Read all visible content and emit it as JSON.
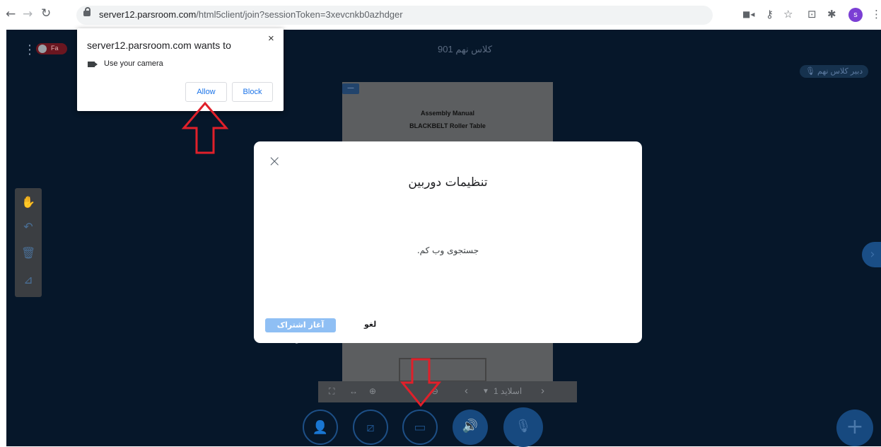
{
  "browser": {
    "url_host": "server12.parsroom.com",
    "url_path": "/html5client/join?sessionToken=3xevcnkb0azhdger",
    "profile_initial": "s",
    "icons": [
      "back-icon",
      "forward-icon",
      "reload-icon",
      "lock-icon",
      "camera-icon",
      "key-icon",
      "star-icon",
      "screenshot-icon",
      "extensions-icon",
      "menu-icon"
    ]
  },
  "permission_popup": {
    "title": "server12.parsroom.com wants to",
    "request": "Use your camera",
    "allow_label": "Allow",
    "block_label": "Block",
    "close_label": "×"
  },
  "app": {
    "room_name": "کلاس نهم 901",
    "language_toggle": "Fa",
    "teacher_badge": "دبیر کلاس نهم",
    "slide": {
      "title_line1": "Assembly Manual",
      "title_line2": "BLACKBELT Roller Table"
    },
    "slide_bar": {
      "slide_label": "اسلاید 1",
      "chevron_left": "‹",
      "chevron_right": "›"
    }
  },
  "modal": {
    "close_label": "×",
    "title": "تنظیمات دوربین",
    "message": "جستجوی وب کم.",
    "share_label": "آغاز اشتراک گذاری",
    "cancel_label": "لغو"
  },
  "colors": {
    "app_background": "#06172a",
    "annotation_arrow": "#e0202a",
    "primary_button": "#8fbff4",
    "link_blue": "#1a73e8"
  }
}
